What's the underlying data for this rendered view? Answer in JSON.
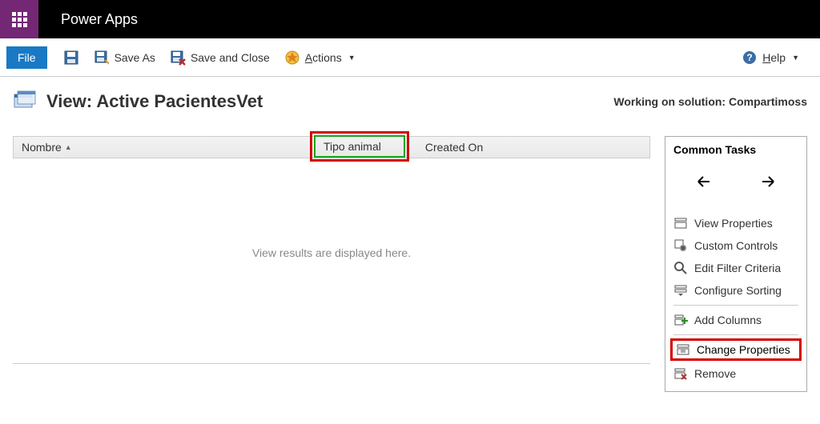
{
  "header": {
    "app_title": "Power Apps"
  },
  "toolbar": {
    "file_label": "File",
    "save_as_label": "Save As",
    "save_close_label": "Save and Close",
    "actions_label": "Actions",
    "actions_underline": "A",
    "help_label": "Help",
    "help_underline": "H"
  },
  "page": {
    "title_prefix": "View: ",
    "title_name": "Active PacientesVet",
    "solution_prefix": "Working on solution: ",
    "solution_name": "Compartimoss"
  },
  "columns": {
    "name": "Nombre",
    "tipo": "Tipo animal",
    "created": "Created On"
  },
  "placeholder": {
    "text": "View results are displayed here."
  },
  "tasks": {
    "title": "Common Tasks",
    "view_properties": "View Properties",
    "custom_controls": "Custom Controls",
    "edit_filter": "Edit Filter Criteria",
    "configure_sorting": "Configure Sorting",
    "add_columns": "Add Columns",
    "change_properties": "Change Properties",
    "remove": "Remove"
  }
}
